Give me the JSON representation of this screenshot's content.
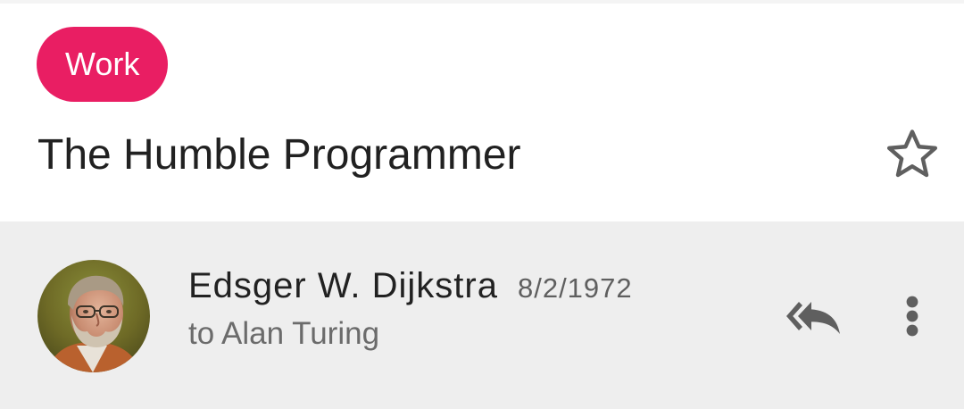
{
  "thread": {
    "label": "Work",
    "subject": "The Humble Programmer",
    "starred": false
  },
  "message": {
    "sender_name": "Edsger W. Dijkstra",
    "date": "8/2/1972",
    "recipient_line": "to Alan Turing"
  },
  "icons": {
    "star": "star-outline-icon",
    "reply_all": "reply-all-icon",
    "overflow": "more-vert-icon",
    "avatar": "sender-photo"
  },
  "colors": {
    "label_chip": "#e91e63",
    "message_header_bg": "#eeeeee",
    "icon_gray": "#5f5f5f"
  }
}
